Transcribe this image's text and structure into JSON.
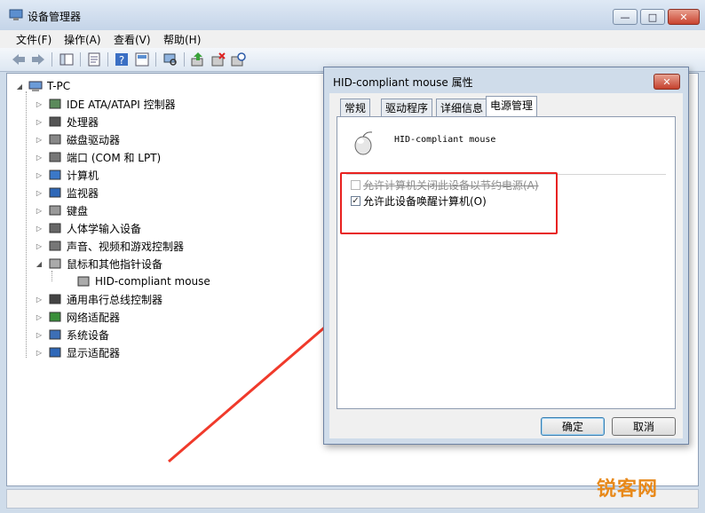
{
  "window": {
    "title": "设备管理器"
  },
  "caption": {
    "minimize": "—",
    "maximize": "□",
    "close": "✕"
  },
  "menu": [
    "文件(F)",
    "操作(A)",
    "查看(V)",
    "帮助(H)"
  ],
  "toolbar_icons": [
    "back-icon",
    "forward-icon",
    "console-tree-icon",
    "properties-icon",
    "help-icon",
    "view-icon",
    "scan-icon",
    "update-driver-icon",
    "uninstall-icon",
    "disable-icon"
  ],
  "tree": {
    "root": "T-PC",
    "items": [
      {
        "label": "IDE ATA/ATAPI 控制器",
        "icon": "ide-icon",
        "expanded": false,
        "indent": 1
      },
      {
        "label": "处理器",
        "icon": "cpu-icon",
        "expanded": false,
        "indent": 1
      },
      {
        "label": "磁盘驱动器",
        "icon": "disk-icon",
        "expanded": false,
        "indent": 1
      },
      {
        "label": "端口 (COM 和 LPT)",
        "icon": "port-icon",
        "expanded": false,
        "indent": 1
      },
      {
        "label": "计算机",
        "icon": "computer-icon",
        "expanded": false,
        "indent": 1
      },
      {
        "label": "监视器",
        "icon": "monitor-icon",
        "expanded": false,
        "indent": 1
      },
      {
        "label": "键盘",
        "icon": "keyboard-icon",
        "expanded": false,
        "indent": 1
      },
      {
        "label": "人体学输入设备",
        "icon": "hid-icon",
        "expanded": false,
        "indent": 1
      },
      {
        "label": "声音、视频和游戏控制器",
        "icon": "sound-icon",
        "expanded": false,
        "indent": 1
      },
      {
        "label": "鼠标和其他指针设备",
        "icon": "mouse-icon",
        "expanded": true,
        "indent": 1
      },
      {
        "label": "HID-compliant mouse",
        "icon": "mouse-icon",
        "expanded": null,
        "indent": 2
      },
      {
        "label": "通用串行总线控制器",
        "icon": "usb-icon",
        "expanded": false,
        "indent": 1
      },
      {
        "label": "网络适配器",
        "icon": "network-icon",
        "expanded": false,
        "indent": 1
      },
      {
        "label": "系统设备",
        "icon": "system-icon",
        "expanded": false,
        "indent": 1
      },
      {
        "label": "显示适配器",
        "icon": "display-icon",
        "expanded": false,
        "indent": 1
      }
    ]
  },
  "dialog": {
    "title": "HID-compliant mouse 属性",
    "close": "✕",
    "tabs": [
      "常规",
      "驱动程序",
      "详细信息",
      "电源管理"
    ],
    "active_tab": 3,
    "device_name": "HID-compliant mouse",
    "options": [
      {
        "label": "允许计算机关闭此设备以节约电源(A)",
        "checked": false,
        "disabled": true
      },
      {
        "label": "允许此设备唤醒计算机(O)",
        "checked": true,
        "disabled": false
      }
    ],
    "ok": "确定",
    "cancel": "取消"
  },
  "watermark": "锐客网",
  "colors": {
    "highlight": "#e8211f",
    "watermark": "#e8891a"
  }
}
